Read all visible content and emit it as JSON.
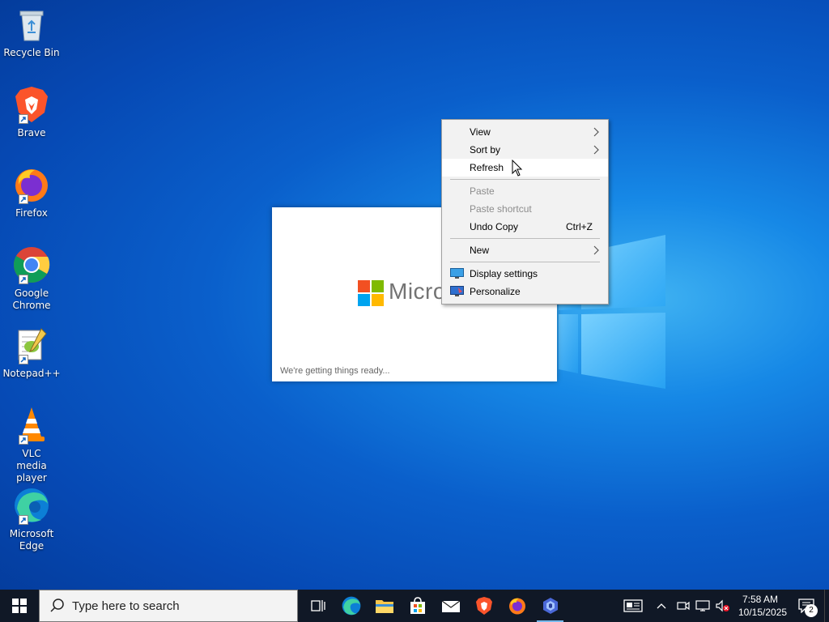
{
  "desktop": {
    "icons": [
      {
        "label": "Recycle Bin",
        "icon": "recycle-bin-icon"
      },
      {
        "label": "Brave",
        "icon": "brave-icon"
      },
      {
        "label": "Firefox",
        "icon": "firefox-icon"
      },
      {
        "label": "Google Chrome",
        "icon": "chrome-icon"
      },
      {
        "label": "Notepad++",
        "icon": "notepadpp-icon"
      },
      {
        "label": "VLC media player",
        "icon": "vlc-icon"
      },
      {
        "label": "Microsoft Edge",
        "icon": "edge-icon"
      }
    ]
  },
  "splash": {
    "brand": "Micros",
    "status": "We're getting things ready..."
  },
  "context_menu": {
    "items": [
      {
        "label": "View",
        "submenu": true
      },
      {
        "label": "Sort by",
        "submenu": true
      },
      {
        "label": "Refresh",
        "hovered": true
      },
      {
        "label": "Paste",
        "disabled": true
      },
      {
        "label": "Paste shortcut",
        "disabled": true
      },
      {
        "label": "Undo Copy",
        "shortcut": "Ctrl+Z"
      },
      {
        "label": "New",
        "submenu": true
      },
      {
        "label": "Display settings",
        "icon": "display-settings-icon"
      },
      {
        "label": "Personalize",
        "icon": "personalize-icon"
      }
    ]
  },
  "taskbar": {
    "search_placeholder": "Type here to search",
    "pinned": [
      "task-view-icon",
      "edge-icon",
      "file-explorer-icon",
      "store-icon",
      "mail-icon",
      "brave-icon",
      "firefox-icon",
      "copilot-icon"
    ],
    "clock": {
      "time": "7:58 AM",
      "date": "10/15/2025"
    },
    "notification_count": "2"
  }
}
